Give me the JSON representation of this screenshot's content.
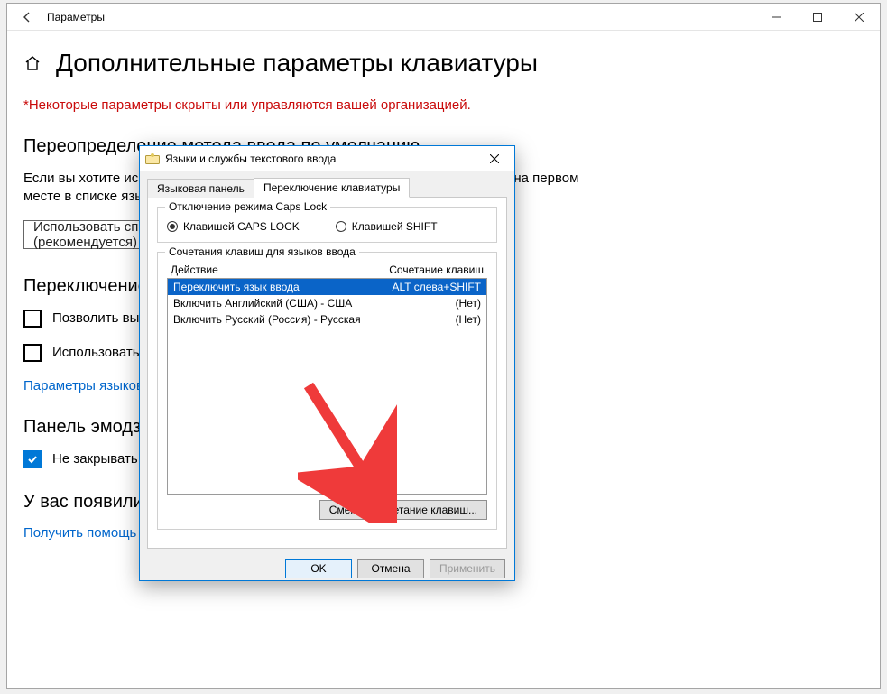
{
  "settingsWindow": {
    "title": "Параметры",
    "pageTitle": "Дополнительные параметры клавиатуры",
    "warning": "*Некоторые параметры скрыты или управляются вашей организацией.",
    "section1": {
      "heading": "Переопределение метода ввода по умолчанию",
      "paragraph": "Если вы хотите использовать метод ввода, отличный от того, который указан на первом месте в списке языков, выберите его здесь.",
      "dropdownValue": "Использовать список языков (рекомендуется)"
    },
    "section2": {
      "heading": "Переключение методов ввода",
      "check1": "Позволить выбирать метод ввода для каждого приложения",
      "check2": "Использовать языковую панель на рабочем столе, если она доступна",
      "link": "Параметры языковой панели"
    },
    "section3": {
      "heading": "Панель эмодзи",
      "check": "Не закрывать панель автоматически после ввода эмодзи"
    },
    "section4": {
      "heading": "У вас появились вопросы?",
      "link": "Получить помощь"
    }
  },
  "dialog": {
    "title": "Языки и службы текстового ввода",
    "tabs": {
      "tab1": "Языковая панель",
      "tab2": "Переключение клавиатуры"
    },
    "group1": {
      "legend": "Отключение режима Caps Lock",
      "opt1": "Клавишей CAPS LOCK",
      "opt2": "Клавишей SHIFT"
    },
    "group2": {
      "legend": "Сочетания клавиш для языков ввода",
      "colAction": "Действие",
      "colHotkey": "Сочетание клавиш",
      "rows": [
        {
          "action": "Переключить язык ввода",
          "hotkey": "ALT слева+SHIFT"
        },
        {
          "action": "Включить Английский (США) - США",
          "hotkey": "(Нет)"
        },
        {
          "action": "Включить Русский (Россия) - Русская",
          "hotkey": "(Нет)"
        }
      ],
      "changeBtn": "Сменить сочетание клавиш..."
    },
    "buttons": {
      "ok": "OK",
      "cancel": "Отмена",
      "apply": "Применить"
    }
  }
}
